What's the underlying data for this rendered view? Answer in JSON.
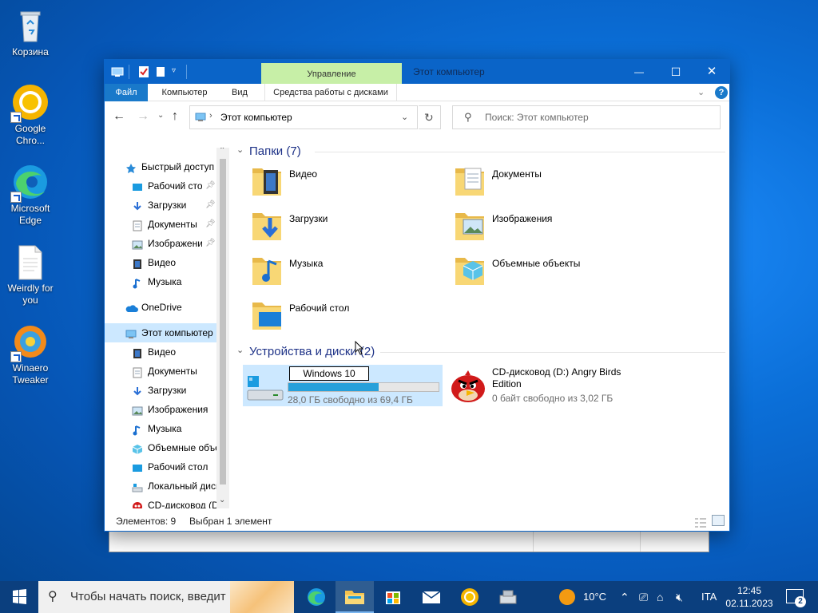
{
  "desktop": {
    "icons": [
      {
        "label": "Корзина",
        "icon": "recycle-bin-icon"
      },
      {
        "label": "Google Chro...",
        "icon": "chrome-icon"
      },
      {
        "label": "Microsoft Edge",
        "icon": "edge-icon"
      },
      {
        "label": "Weirdly for you",
        "icon": "document-icon"
      },
      {
        "label": "Winaero Tweaker",
        "icon": "winaero-icon"
      }
    ]
  },
  "window": {
    "title": "Этот компьютер",
    "contextual_tab": "Управление",
    "controls": {
      "minimize": "—",
      "maximize": "☐",
      "close": "✕"
    },
    "ribbon_tabs": [
      "Файл",
      "Компьютер",
      "Вид",
      "Средства работы с дисками"
    ],
    "address": "Этот компьютер",
    "search_placeholder": "Поиск: Этот компьютер",
    "help": "?"
  },
  "nav": {
    "items": [
      {
        "label": "Быстрый доступ",
        "icon": "star-icon",
        "indent": 0,
        "pinned": false
      },
      {
        "label": "Рабочий стол",
        "icon": "desktop-icon",
        "indent": 1,
        "pinned": true
      },
      {
        "label": "Загрузки",
        "icon": "download-icon",
        "indent": 1,
        "pinned": true
      },
      {
        "label": "Документы",
        "icon": "documents-icon",
        "indent": 1,
        "pinned": true
      },
      {
        "label": "Изображения",
        "icon": "pictures-icon",
        "indent": 1,
        "pinned": true
      },
      {
        "label": "Видео",
        "icon": "video-icon",
        "indent": 1,
        "pinned": false
      },
      {
        "label": "Музыка",
        "icon": "music-icon",
        "indent": 1,
        "pinned": false
      },
      {
        "label": "OneDrive",
        "icon": "onedrive-icon",
        "indent": 0,
        "pinned": false
      },
      {
        "label": "Этот компьютер",
        "icon": "computer-icon",
        "indent": 0,
        "pinned": false,
        "selected": true
      },
      {
        "label": "Видео",
        "icon": "video-icon",
        "indent": 1,
        "pinned": false
      },
      {
        "label": "Документы",
        "icon": "documents-icon",
        "indent": 1,
        "pinned": false
      },
      {
        "label": "Загрузки",
        "icon": "download-icon",
        "indent": 1,
        "pinned": false
      },
      {
        "label": "Изображения",
        "icon": "pictures-icon",
        "indent": 1,
        "pinned": false
      },
      {
        "label": "Музыка",
        "icon": "music-icon",
        "indent": 1,
        "pinned": false
      },
      {
        "label": "Объемные объекты",
        "icon": "3d-objects-icon",
        "indent": 1,
        "pinned": false
      },
      {
        "label": "Рабочий стол",
        "icon": "desktop-icon",
        "indent": 1,
        "pinned": false
      },
      {
        "label": "Локальный диск",
        "icon": "drive-icon",
        "indent": 1,
        "pinned": false
      },
      {
        "label": "CD-дисковод (D:)",
        "icon": "cd-icon",
        "indent": 1,
        "pinned": false
      }
    ]
  },
  "content": {
    "folders_header": "Папки (7)",
    "folders": [
      {
        "label": "Видео",
        "icon": "video-folder-icon"
      },
      {
        "label": "Документы",
        "icon": "documents-folder-icon"
      },
      {
        "label": "Загрузки",
        "icon": "downloads-folder-icon"
      },
      {
        "label": "Изображения",
        "icon": "pictures-folder-icon"
      },
      {
        "label": "Музыка",
        "icon": "music-folder-icon"
      },
      {
        "label": "Объемные объекты",
        "icon": "3d-objects-folder-icon"
      },
      {
        "label": "Рабочий стол",
        "icon": "desktop-folder-icon"
      }
    ],
    "devices_header": "Устройства и диски (2)",
    "drives": [
      {
        "rename_value": "Windows 10",
        "free": "28,0 ГБ свободно из 69,4 ГБ",
        "used_fraction": 0.6
      },
      {
        "label": "CD-дисковод (D:) Angry Birds Edition",
        "free": "0 байт свободно из 3,02 ГБ"
      }
    ]
  },
  "status": {
    "count": "Элементов: 9",
    "selected": "Выбран 1 элемент"
  },
  "taskbar": {
    "search_placeholder": "Чтобы начать поиск, введит",
    "pinned": [
      "edge-icon",
      "file-explorer-icon",
      "store-icon",
      "mail-icon",
      "chrome-icon",
      "app-icon"
    ],
    "weather": "10°C",
    "language": "ITA",
    "time": "12:45",
    "date": "02.11.2023",
    "notifications": "2"
  },
  "colors": {
    "accent": "#0a64c8",
    "contextual": "#c7efa7",
    "selection": "#cce8ff",
    "link_header": "#1e3287",
    "drive_bar": "#26a0da"
  }
}
